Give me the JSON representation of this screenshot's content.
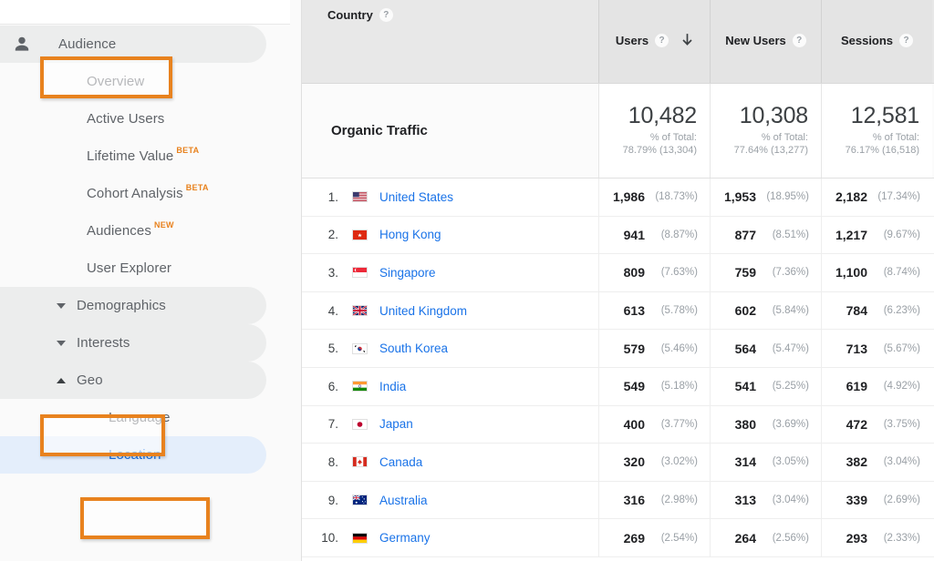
{
  "colors": {
    "accent_orange": "#e8821e",
    "link_blue": "#1a73e8",
    "selected_row_bg": "#e4eefb",
    "section_row_bg": "#eceded",
    "header_bg": "#e8e8e8"
  },
  "sidebar": {
    "items": [
      {
        "label": "Audience",
        "type": "section",
        "icon": "person-icon",
        "badge": "",
        "state": "active",
        "highlighted": true
      },
      {
        "label": "Overview",
        "type": "leaf",
        "icon": "",
        "badge": "",
        "state": "",
        "highlighted": false
      },
      {
        "label": "Active Users",
        "type": "leaf",
        "icon": "",
        "badge": "",
        "state": "",
        "highlighted": false
      },
      {
        "label": "Lifetime Value",
        "type": "leaf",
        "icon": "",
        "badge": "BETA",
        "state": "",
        "highlighted": false
      },
      {
        "label": "Cohort Analysis",
        "type": "leaf",
        "icon": "",
        "badge": "BETA",
        "state": "",
        "highlighted": false
      },
      {
        "label": "Audiences",
        "type": "leaf",
        "icon": "",
        "badge": "NEW",
        "state": "",
        "highlighted": false
      },
      {
        "label": "User Explorer",
        "type": "leaf",
        "icon": "",
        "badge": "",
        "state": "",
        "highlighted": false
      },
      {
        "label": "Demographics",
        "type": "group",
        "icon": "chevron-down-icon",
        "badge": "",
        "state": "collapsed",
        "highlighted": false
      },
      {
        "label": "Interests",
        "type": "group",
        "icon": "chevron-down-icon",
        "badge": "",
        "state": "collapsed",
        "highlighted": false
      },
      {
        "label": "Geo",
        "type": "group",
        "icon": "chevron-up-icon",
        "badge": "",
        "state": "expanded",
        "highlighted": true
      },
      {
        "label": "Language",
        "type": "subleaf",
        "icon": "",
        "badge": "",
        "state": "",
        "highlighted": false
      },
      {
        "label": "Location",
        "type": "subleaf",
        "icon": "",
        "badge": "",
        "state": "selected",
        "highlighted": true
      }
    ]
  },
  "table": {
    "columns": [
      {
        "key": "country",
        "label": "Country",
        "help": "?",
        "sorted": false
      },
      {
        "key": "users",
        "label": "Users",
        "help": "?",
        "sorted": true,
        "sort_dir": "desc"
      },
      {
        "key": "new_users",
        "label": "New Users",
        "help": "?",
        "sorted": false
      },
      {
        "key": "sessions",
        "label": "Sessions",
        "help": "?",
        "sorted": false
      }
    ],
    "summary": {
      "label": "Organic Traffic",
      "pct_of_total_label": "% of Total:",
      "metrics": [
        {
          "value": "10,482",
          "of_total": "78.79% (13,304)"
        },
        {
          "value": "10,308",
          "of_total": "77.64% (13,277)"
        },
        {
          "value": "12,581",
          "of_total": "76.17% (16,518)"
        }
      ]
    },
    "rows": [
      {
        "rank": "1.",
        "country": "United States",
        "flag": "flag-us",
        "users": "1,986",
        "users_pct": "(18.73%)",
        "new_users": "1,953",
        "new_users_pct": "(18.95%)",
        "sessions": "2,182",
        "sessions_pct": "(17.34%)"
      },
      {
        "rank": "2.",
        "country": "Hong Kong",
        "flag": "flag-hk",
        "users": "941",
        "users_pct": "(8.87%)",
        "new_users": "877",
        "new_users_pct": "(8.51%)",
        "sessions": "1,217",
        "sessions_pct": "(9.67%)"
      },
      {
        "rank": "3.",
        "country": "Singapore",
        "flag": "flag-sg",
        "users": "809",
        "users_pct": "(7.63%)",
        "new_users": "759",
        "new_users_pct": "(7.36%)",
        "sessions": "1,100",
        "sessions_pct": "(8.74%)"
      },
      {
        "rank": "4.",
        "country": "United Kingdom",
        "flag": "flag-gb",
        "users": "613",
        "users_pct": "(5.78%)",
        "new_users": "602",
        "new_users_pct": "(5.84%)",
        "sessions": "784",
        "sessions_pct": "(6.23%)"
      },
      {
        "rank": "5.",
        "country": "South Korea",
        "flag": "flag-kr",
        "users": "579",
        "users_pct": "(5.46%)",
        "new_users": "564",
        "new_users_pct": "(5.47%)",
        "sessions": "713",
        "sessions_pct": "(5.67%)"
      },
      {
        "rank": "6.",
        "country": "India",
        "flag": "flag-in",
        "users": "549",
        "users_pct": "(5.18%)",
        "new_users": "541",
        "new_users_pct": "(5.25%)",
        "sessions": "619",
        "sessions_pct": "(4.92%)"
      },
      {
        "rank": "7.",
        "country": "Japan",
        "flag": "flag-jp",
        "users": "400",
        "users_pct": "(3.77%)",
        "new_users": "380",
        "new_users_pct": "(3.69%)",
        "sessions": "472",
        "sessions_pct": "(3.75%)"
      },
      {
        "rank": "8.",
        "country": "Canada",
        "flag": "flag-ca",
        "users": "320",
        "users_pct": "(3.02%)",
        "new_users": "314",
        "new_users_pct": "(3.05%)",
        "sessions": "382",
        "sessions_pct": "(3.04%)"
      },
      {
        "rank": "9.",
        "country": "Australia",
        "flag": "flag-au",
        "users": "316",
        "users_pct": "(2.98%)",
        "new_users": "313",
        "new_users_pct": "(3.04%)",
        "sessions": "339",
        "sessions_pct": "(2.69%)"
      },
      {
        "rank": "10.",
        "country": "Germany",
        "flag": "flag-de",
        "users": "269",
        "users_pct": "(2.54%)",
        "new_users": "264",
        "new_users_pct": "(2.56%)",
        "sessions": "293",
        "sessions_pct": "(2.33%)"
      }
    ]
  }
}
